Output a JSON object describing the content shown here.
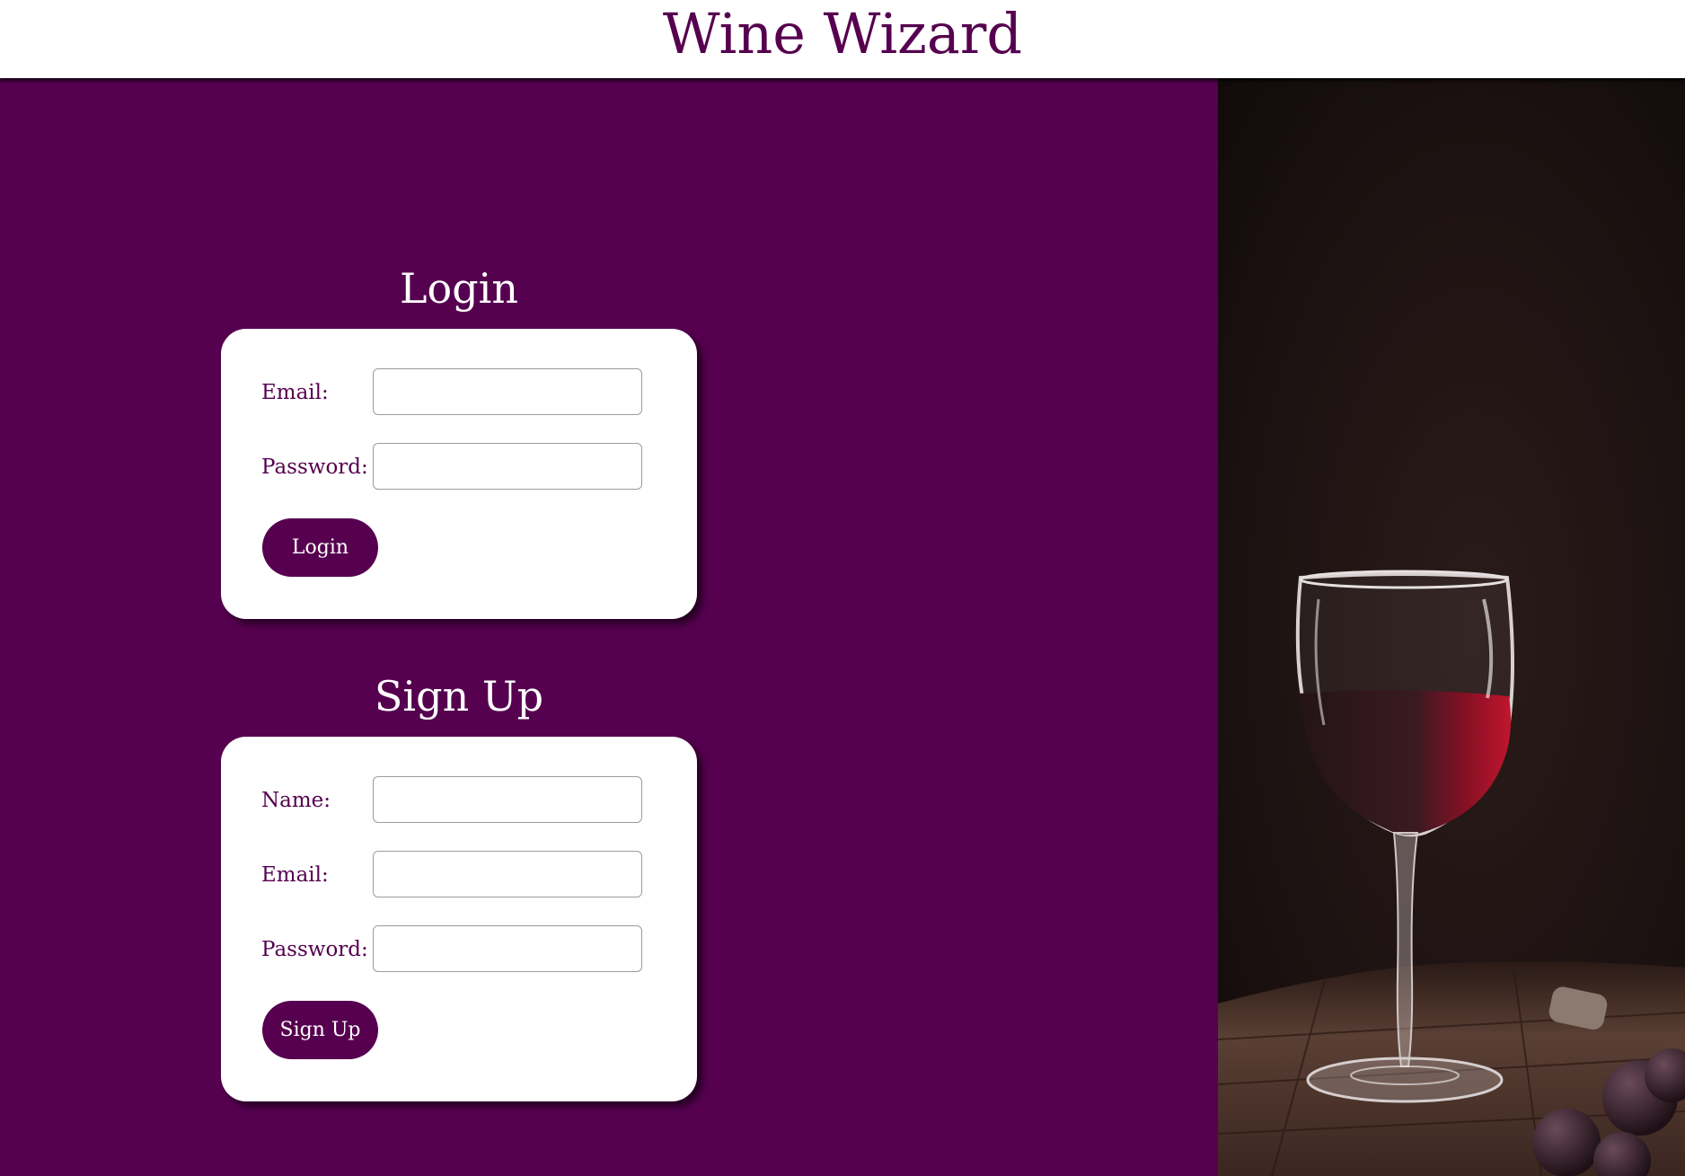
{
  "header": {
    "title": "Wine Wizard"
  },
  "login": {
    "title": "Login",
    "email_label": "Email:",
    "email_value": "",
    "password_label": "Password:",
    "password_value": "",
    "button_label": "Login"
  },
  "signup": {
    "title": "Sign Up",
    "name_label": "Name:",
    "name_value": "",
    "email_label": "Email:",
    "email_value": "",
    "password_label": "Password:",
    "password_value": "",
    "button_label": "Sign Up"
  },
  "colors": {
    "brand": "#56004f",
    "left_background": "#560050",
    "card_background": "#ffffff",
    "wine": "#a0142a"
  },
  "photo": {
    "subject": "wine-glass-photo"
  }
}
